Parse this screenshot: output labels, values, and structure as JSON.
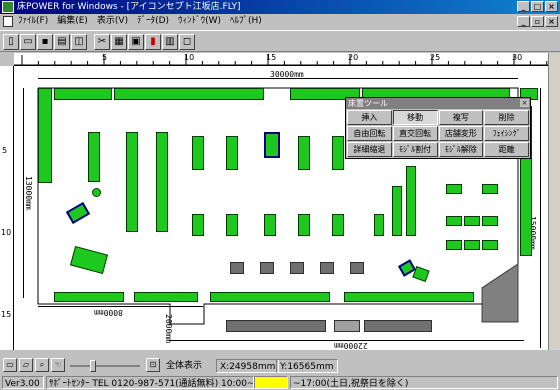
{
  "window": {
    "title": "床POWER for Windows - [アイコンセプト江坂店.FLY]",
    "caption_buttons": [
      "_",
      "□",
      "×"
    ],
    "mdi_buttons": [
      "_",
      "▫",
      "×"
    ]
  },
  "menu": {
    "items": [
      "ﾌｧｲﾙ(F)",
      "編集(E)",
      "表示(V)",
      "ﾃﾞｰﾀ(D)",
      "ｳｨﾝﾄﾞｳ(W)",
      "ﾍﾙﾌﾟ(H)"
    ]
  },
  "toolbar": {
    "icons": [
      "new-icon",
      "open-icon",
      "save-icon",
      "print-icon",
      "preview-icon",
      "cut-icon",
      "copy-icon",
      "paste-icon",
      "chart-icon",
      "layout-icon",
      "window-icon"
    ]
  },
  "ruler": {
    "top_labels": [
      "5",
      "10",
      "15",
      "20",
      "25",
      "30"
    ],
    "left_labels": [
      "5",
      "10",
      "15"
    ]
  },
  "canvas": {
    "dim_width_top": "30000mm",
    "dim_height_left": "13000mm",
    "dim_height_right": "15000mm",
    "dim_bottom_left": "8000mm",
    "dim_bottom_right": "22000mm",
    "dim_step": "2000mm"
  },
  "palette": {
    "title": "床置ツール",
    "close": "×",
    "buttons": [
      "挿入",
      "移動",
      "複写",
      "削除",
      "自由回転",
      "直交回転",
      "店舗変形",
      "ﾌｪｲｼﾝｸﾞ",
      "詳細縮退",
      "ﾓｼﾞﾙ割付",
      "ﾓｼﾞﾙ解除",
      "距離"
    ],
    "active_index": 1
  },
  "bottom": {
    "fit_label": "全体表示",
    "x_coord": "X:24958mm",
    "y_coord": "Y:16565mm"
  },
  "status": {
    "version": "Ver3.00",
    "support": "ｻﾎﾟｰﾄｾﾝﾀｰ TEL 0120-987-571(通話無料) 10:00~",
    "hours": "~17:00(土日,祝祭日を除く)",
    "highlight_color": "#ffff00"
  },
  "colors": {
    "fixture": "#1ec81e",
    "selected_fixture": "#00008b",
    "gray_fixture": "#707070"
  }
}
